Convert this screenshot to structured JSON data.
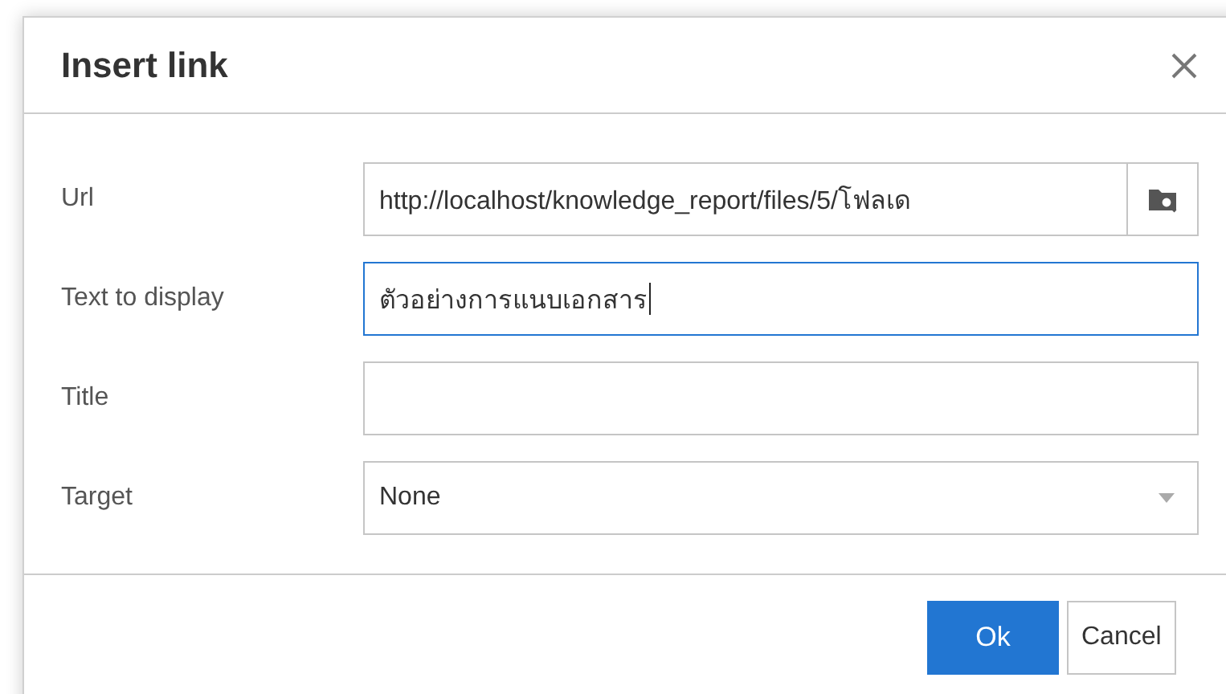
{
  "dialog": {
    "title": "Insert link",
    "fields": [
      {
        "kind": "browse",
        "label": "Url",
        "value": "http://localhost/knowledge_report/files/5/โฟลเด",
        "focused": false
      },
      {
        "kind": "text",
        "label": "Text to display",
        "value": "ตัวอย่างการแนบเอกสาร",
        "focused": true
      },
      {
        "kind": "text",
        "label": "Title",
        "focused": false
      },
      {
        "kind": "select",
        "label": "Target",
        "value": "None",
        "focused": false
      }
    ],
    "buttons": [
      {
        "label": "Ok",
        "primary": true
      },
      {
        "label": "Cancel",
        "primary": false
      }
    ]
  }
}
